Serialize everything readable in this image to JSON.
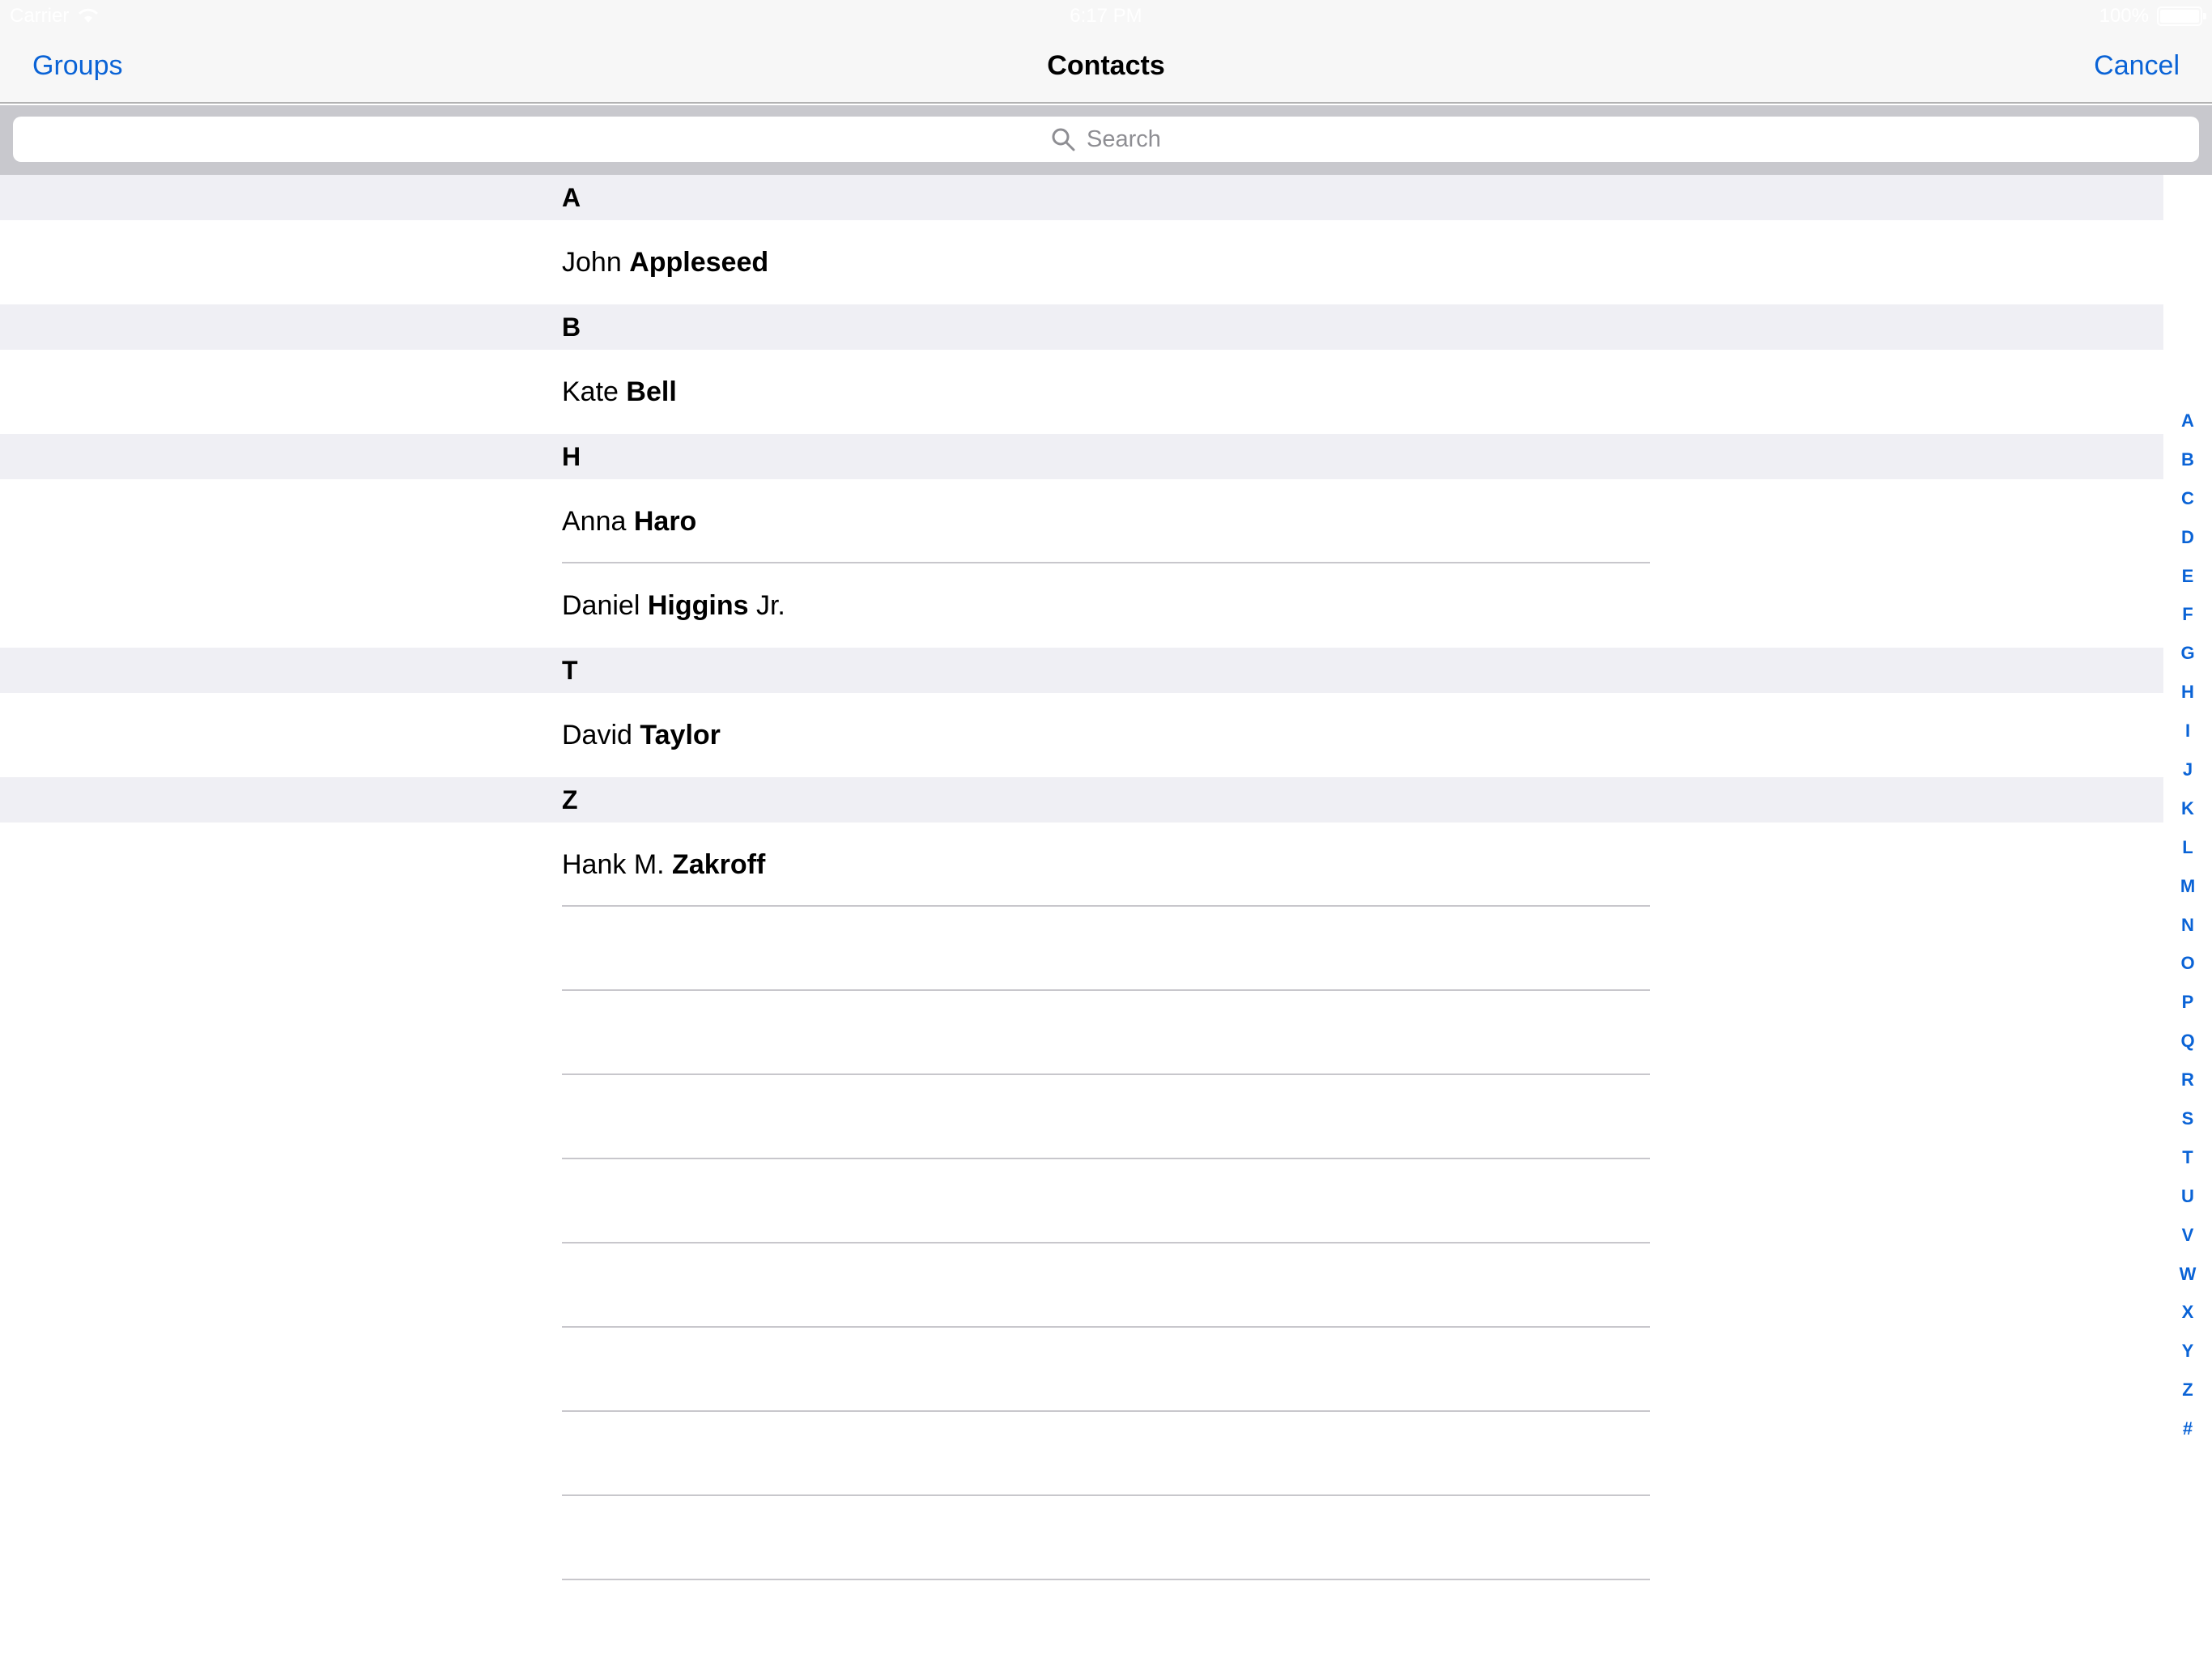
{
  "status_bar": {
    "carrier": "Carrier",
    "time": "6:17 PM",
    "battery": "100%"
  },
  "nav": {
    "left_button": "Groups",
    "title": "Contacts",
    "right_button": "Cancel"
  },
  "search": {
    "placeholder": "Search"
  },
  "sections": [
    {
      "header": "A",
      "contacts": [
        {
          "first": "John",
          "last": "Appleseed",
          "suffix": ""
        }
      ]
    },
    {
      "header": "B",
      "contacts": [
        {
          "first": "Kate",
          "last": "Bell",
          "suffix": ""
        }
      ]
    },
    {
      "header": "H",
      "contacts": [
        {
          "first": "Anna",
          "last": "Haro",
          "suffix": ""
        },
        {
          "first": "Daniel",
          "last": "Higgins",
          "suffix": "Jr."
        }
      ]
    },
    {
      "header": "T",
      "contacts": [
        {
          "first": "David",
          "last": "Taylor",
          "suffix": ""
        }
      ]
    },
    {
      "header": "Z",
      "contacts": [
        {
          "first": "Hank M.",
          "last": "Zakroff",
          "suffix": ""
        }
      ]
    }
  ],
  "index": [
    "A",
    "B",
    "C",
    "D",
    "E",
    "F",
    "G",
    "H",
    "I",
    "J",
    "K",
    "L",
    "M",
    "N",
    "O",
    "P",
    "Q",
    "R",
    "S",
    "T",
    "U",
    "V",
    "W",
    "X",
    "Y",
    "Z",
    "#"
  ],
  "colors": {
    "accent": "#0a63d6",
    "section_bg": "#efeff4",
    "nav_bg": "#f7f7f7",
    "search_bg": "#c8c8cd"
  }
}
